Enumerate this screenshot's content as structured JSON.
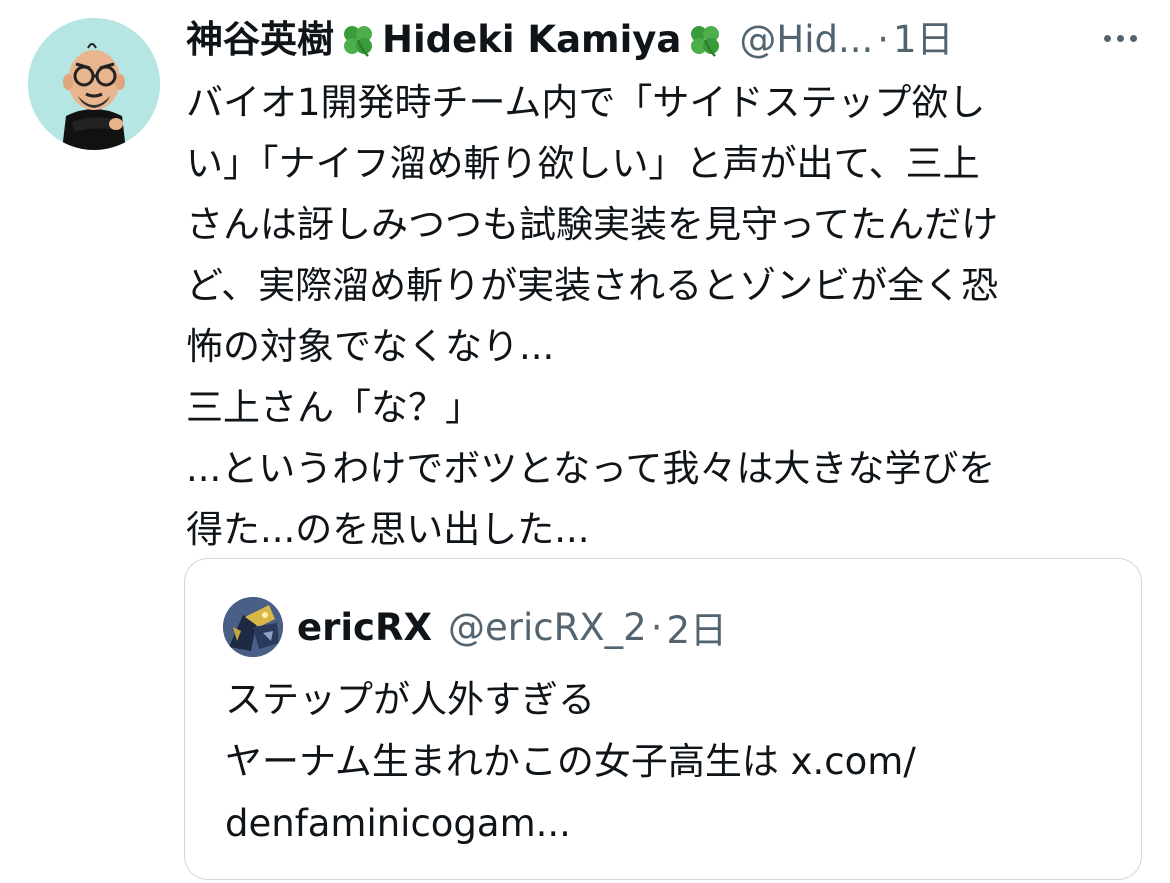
{
  "tweet": {
    "author": {
      "display_name": "神谷英樹",
      "display_name_latin": "Hideki Kamiya",
      "handle": "@Hid...",
      "avatar_icon": "cartoon-bald-man-with-glasses-avatar",
      "emoji_icon": "four-leaf-clover-icon"
    },
    "separator": "·",
    "time": "1日",
    "more_icon": "ellipsis-icon",
    "body_lines": [
      "バイオ1開発時チーム内で「サイドステップ欲し",
      "い」「ナイフ溜め斬り欲しい」と声が出て、三上",
      "さんは訝しみつつも試験実装を見守ってたんだけ",
      "ど、実際溜め斬りが実装されるとゾンビが全く恐",
      "怖の対象でなくなり...",
      "三上さん「な？」",
      "...というわけでボツとなって我々は大きな学びを",
      "得た...のを思い出した..."
    ]
  },
  "quoted_tweet": {
    "author": {
      "display_name": "ericRX",
      "handle": "@ericRX_2",
      "avatar_icon": "robot-mecha-avatar"
    },
    "separator": "·",
    "time": "2日",
    "body_lines": [
      "ステップが人外すぎる",
      "ヤーナム生まれかこの女子高生は x.com/",
      "denfaminicogam..."
    ]
  },
  "colors": {
    "text_primary": "#0f1419",
    "text_secondary": "#536471",
    "border": "#cfd9de",
    "avatar_bg": "#b5e6e4",
    "clover_green": "#3a9b3a"
  }
}
